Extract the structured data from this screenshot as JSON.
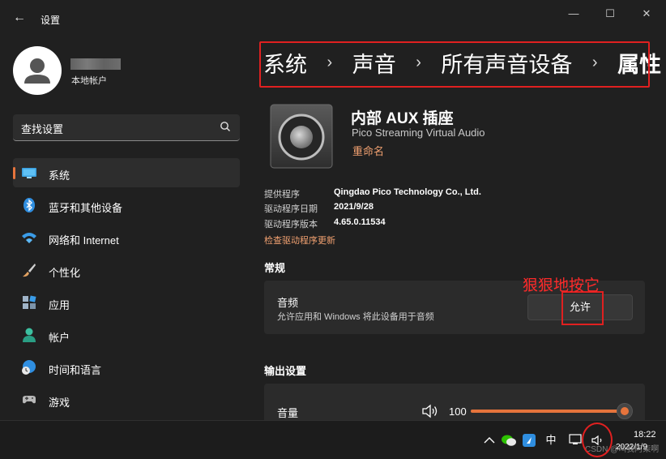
{
  "window": {
    "title": "设置",
    "back_glyph": "←",
    "minimize_glyph": "—",
    "maximize_glyph": "☐",
    "close_glyph": "✕"
  },
  "account": {
    "type": "本地帐户"
  },
  "search": {
    "value": "查找设置"
  },
  "nav": {
    "items": [
      {
        "label": "系统",
        "icon": "system-monitor-icon"
      },
      {
        "label": "蓝牙和其他设备",
        "icon": "bluetooth-icon"
      },
      {
        "label": "网络和 Internet",
        "icon": "wifi-icon"
      },
      {
        "label": "个性化",
        "icon": "brush-icon"
      },
      {
        "label": "应用",
        "icon": "apps-icon"
      },
      {
        "label": "帐户",
        "icon": "person-icon"
      },
      {
        "label": "时间和语言",
        "icon": "globe-clock-icon"
      },
      {
        "label": "游戏",
        "icon": "gamepad-icon"
      }
    ]
  },
  "breadcrumb": {
    "items": [
      "系统",
      "声音",
      "所有声音设备",
      "属性"
    ],
    "separator": "›"
  },
  "device": {
    "name": "内部 AUX 插座",
    "subtitle": "Pico Streaming Virtual Audio",
    "rename": "重命名"
  },
  "driver": {
    "rows": [
      {
        "label": "提供程序",
        "value": "Qingdao Pico Technology Co., Ltd."
      },
      {
        "label": "驱动程序日期",
        "value": "2021/9/28"
      },
      {
        "label": "驱动程序版本",
        "value": "4.65.0.11534"
      }
    ],
    "check_update": "检查驱动程序更新"
  },
  "general": {
    "title": "常规",
    "audio_title": "音频",
    "audio_desc": "允许应用和 Windows 将此设备用于音频",
    "allow_label": "允许"
  },
  "annotation": "狠狠地按它",
  "output": {
    "title": "输出设置",
    "volume_label": "音量",
    "volume_value": "100",
    "volume_level": 1.0
  },
  "taskbar": {
    "ime": "中",
    "time": "18:22",
    "date": "2022/1/9",
    "watermark": "CSDN @叫我阿柒啊"
  },
  "colors": {
    "accent": "#e6743c",
    "annotation_red": "#e02020",
    "link": "#f0a070"
  }
}
